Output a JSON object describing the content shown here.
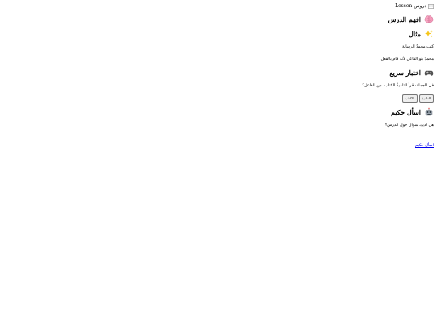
{
  "header": {
    "icon": "book-icon",
    "title": "دروس Lesson"
  },
  "sections": [
    {
      "icon": "brain-icon",
      "title": "افهم الدرس"
    },
    {
      "icon": "sparkles-icon",
      "title": "مثال",
      "lines": [
        "كتب محمدٌ الرسالة",
        "محمدٌ هو الفاعل لأنه قام بالفعل."
      ]
    },
    {
      "icon": "game-controller-icon",
      "title": "اختبار سريع",
      "question": "في الجملة: قرأ التلميذُ الكتاب، من الفاعل؟",
      "options": [
        "التلميذ",
        "الكتاب"
      ]
    },
    {
      "icon": "robot-icon",
      "title": "اسأل حكيم",
      "prompt": "هل لديك سؤال حول الدرس؟",
      "link_label": "اسأل حكيم"
    }
  ]
}
